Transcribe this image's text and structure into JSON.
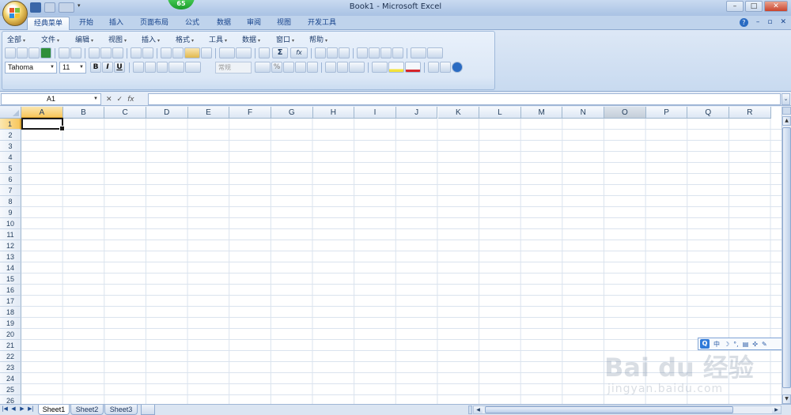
{
  "window": {
    "title": "Book1 - Microsoft Excel",
    "badge": "65",
    "controls": [
      "–",
      "□",
      "✕"
    ]
  },
  "ribbon_tabs": [
    "经典菜单",
    "开始",
    "插入",
    "页面布局",
    "公式",
    "数据",
    "审阅",
    "视图",
    "开发工具"
  ],
  "ribbon_right": {
    "help": "?",
    "min": "–",
    "restore": "▫",
    "close": "✕"
  },
  "menus": [
    "全部",
    "文件",
    "编辑",
    "视图",
    "插入",
    "格式",
    "工具",
    "数据",
    "窗口",
    "帮助"
  ],
  "font": {
    "name": "Tahoma",
    "size": "11"
  },
  "format_buttons": {
    "bold": "B",
    "italic": "I",
    "underline": "U"
  },
  "number_format": "常规",
  "toolbar_symbols": {
    "sum": "Σ",
    "fx": "fx",
    "percent": "%"
  },
  "formula_bar": {
    "name_box": "A1",
    "fx_label": "fx",
    "cancel": "✕",
    "enter": "✓",
    "value": ""
  },
  "columns": [
    "A",
    "B",
    "C",
    "D",
    "E",
    "F",
    "G",
    "H",
    "I",
    "J",
    "K",
    "L",
    "M",
    "N",
    "O",
    "P",
    "Q",
    "R"
  ],
  "rows": [
    "1",
    "2",
    "3",
    "4",
    "5",
    "6",
    "7",
    "8",
    "9",
    "10",
    "11",
    "12",
    "13",
    "14",
    "15",
    "16",
    "17",
    "18",
    "19",
    "20",
    "21",
    "22",
    "23",
    "24",
    "25",
    "26"
  ],
  "active_cell": "A1",
  "sheets": [
    "Sheet1",
    "Sheet2",
    "Sheet3"
  ],
  "active_sheet": "Sheet1",
  "ime": {
    "label": "中"
  },
  "watermark": {
    "main": "Bai du 经验",
    "url": "jingyan.baidu.com"
  },
  "colors": {
    "accent": "#2a6bc2",
    "selected_header": "#f8c65b",
    "grid_line": "#dae3ee"
  }
}
